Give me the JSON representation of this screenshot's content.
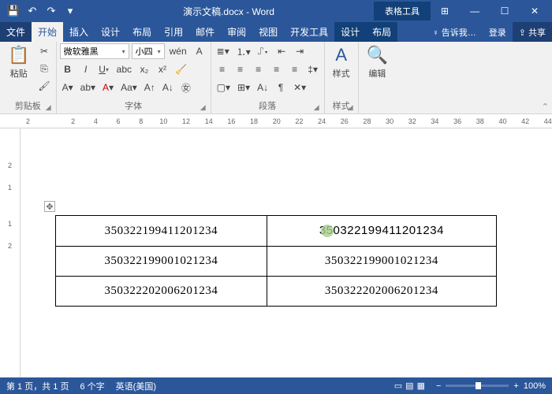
{
  "qat": {
    "save": "💾",
    "undo": "↶",
    "redo": "↷",
    "more": "▾"
  },
  "title": "演示文稿.docx - Word",
  "contextual_title": "表格工具",
  "win": {
    "opts": "⊞",
    "min": "—",
    "max": "☐",
    "close": "✕"
  },
  "tabs": {
    "file": "文件",
    "home": "开始",
    "insert": "插入",
    "design": "设计",
    "layout": "布局",
    "references": "引用",
    "mailings": "邮件",
    "review": "审阅",
    "view": "视图",
    "dev": "开发工具",
    "ctx_design": "设计",
    "ctx_layout": "布局",
    "tell": "♀ 告诉我…",
    "login": "登录",
    "share": "⇪ 共享"
  },
  "ribbon": {
    "clipboard": {
      "paste": "粘贴",
      "label": "剪贴板"
    },
    "font": {
      "name": "微软雅黑",
      "size": "小四",
      "label": "字体"
    },
    "paragraph": {
      "label": "段落"
    },
    "styles": {
      "btn": "样式",
      "label": "样式"
    },
    "editing": {
      "btn": "编辑"
    }
  },
  "ruler_h": [
    "2",
    "",
    "2",
    "4",
    "6",
    "8",
    "10",
    "12",
    "14",
    "16",
    "18",
    "20",
    "22",
    "24",
    "26",
    "28",
    "30",
    "32",
    "34",
    "36",
    "38",
    "40",
    "42",
    "44"
  ],
  "ruler_v": [
    "",
    "",
    "2",
    "1",
    "",
    "1",
    "2"
  ],
  "table": {
    "rows": [
      [
        "350322199411201234",
        "350322199411201234"
      ],
      [
        "350322199001021234",
        "350322199001021234"
      ],
      [
        "350322202006201234",
        "350322202006201234"
      ]
    ]
  },
  "status": {
    "page": "第 1 页，共 1 页",
    "words": "6 个字",
    "lang": "英语(美国)",
    "zoom_minus": "−",
    "zoom_plus": "+",
    "zoom_pct": "100%"
  }
}
